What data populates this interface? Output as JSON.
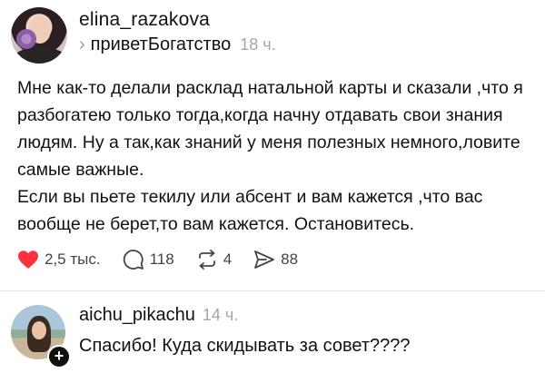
{
  "post": {
    "username": "elina_razakova",
    "chevron": "›",
    "topic": "приветБогатство",
    "time": "18 ч.",
    "paragraphs": [
      "Мне как-то делали расклад натальной карты и сказали ,что я разбогатею только тогда,когда начну отдавать свои знания людям. Ну а так,как знаний у меня полезных немного,ловите самые важные.",
      "Если вы пьете текилу или абсент и вам кажется ,что вас вообще не берет,то вам кажется. Остановитесь."
    ],
    "actions": {
      "likes": "2,5 тыс.",
      "comments": "118",
      "reposts": "4",
      "shares": "88"
    }
  },
  "reply": {
    "username": "aichu_pikachu",
    "time": "14 ч.",
    "text": "Спасибо! Куда скидывать за совет????",
    "badge": "+"
  },
  "colors": {
    "like": "#ff3040",
    "muted": "#a6a6a6",
    "text": "#111111"
  }
}
